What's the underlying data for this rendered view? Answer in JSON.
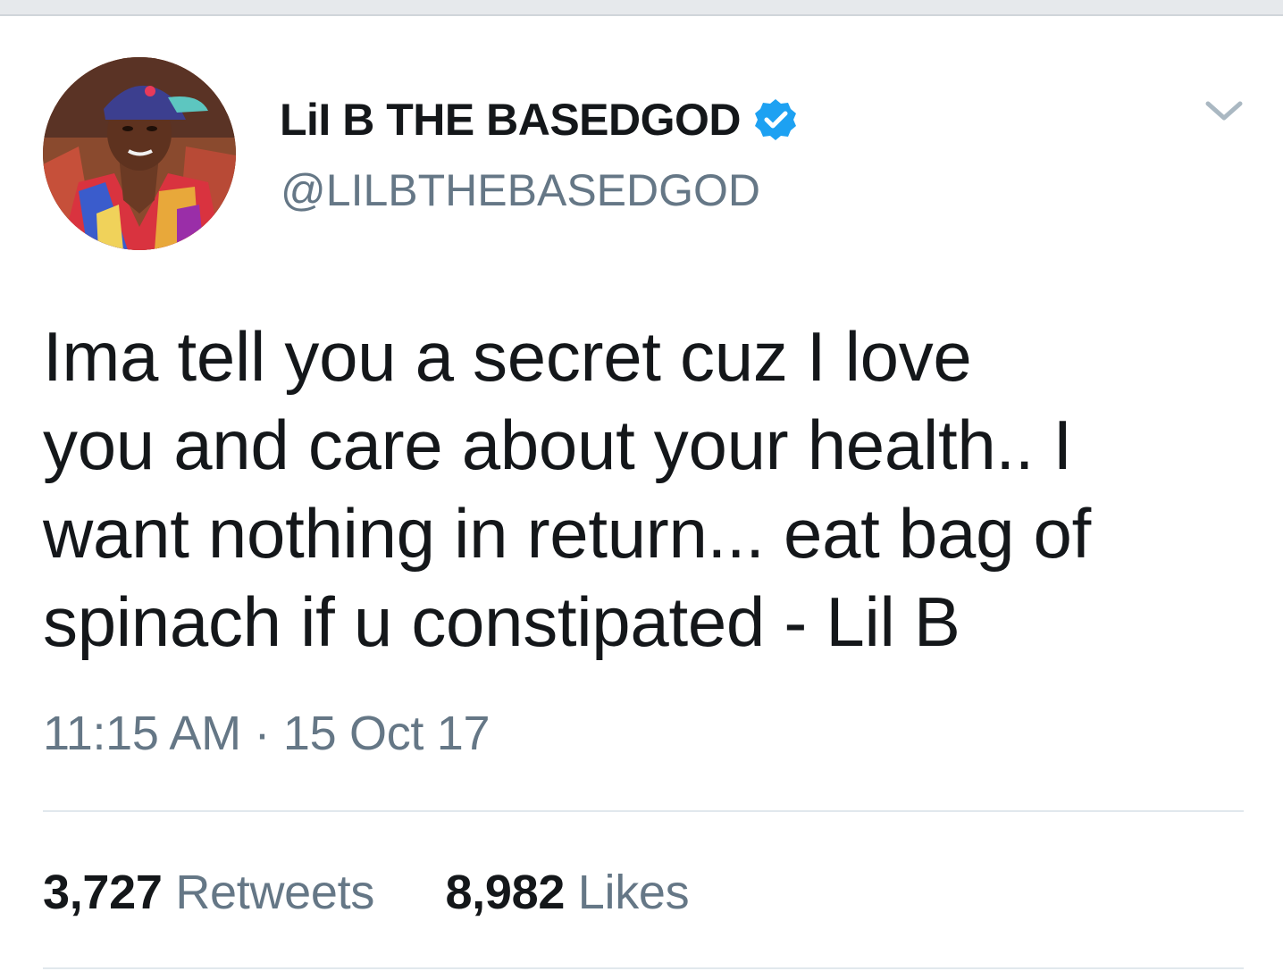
{
  "user": {
    "display_name": "LiI B THE BASEDGOD",
    "handle": "@LILBTHEBASEDGOD",
    "verified_icon": "verified-badge-icon",
    "avatar_icon": "profile-photo"
  },
  "menu": {
    "caret_icon": "chevron-down-icon"
  },
  "tweet": {
    "lines": [
      "Ima tell you a secret cuz I love",
      "you and care about your health.. I",
      "want nothing in return... eat bag of",
      "spinach if u constipated - Lil B"
    ],
    "timestamp": "11:15 AM · 15 Oct 17"
  },
  "stats": {
    "retweets_count": "3,727",
    "retweets_label": "Retweets",
    "likes_count": "8,982",
    "likes_label": "Likes"
  },
  "colors": {
    "text_primary": "#14171a",
    "text_secondary": "#657786",
    "verified_blue": "#1da1f2",
    "divider": "#e1e8ed"
  }
}
